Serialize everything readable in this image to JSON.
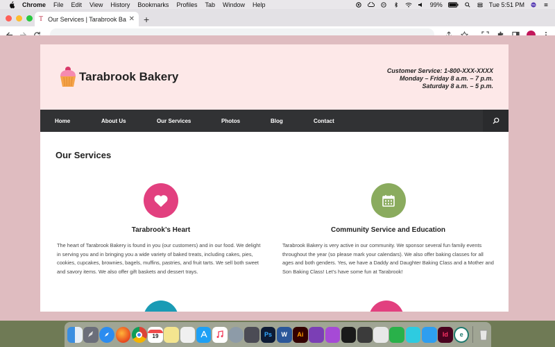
{
  "menubar": {
    "menus": [
      "Chrome",
      "File",
      "Edit",
      "View",
      "History",
      "Bookmarks",
      "Profiles",
      "Tab",
      "Window",
      "Help"
    ],
    "battery": "99%",
    "clock": "Tue 5:51 PM"
  },
  "browser": {
    "tab_title": "Our Services | Tarabrook Bake",
    "tab_favicon": "T",
    "new_tab": "+"
  },
  "site": {
    "brand": "Tarabrook Bakery",
    "contact": {
      "line1": "Customer Service: 1-800-XXX-XXXX",
      "line2": "Monday – Friday 8 a.m. – 7 p.m.",
      "line3": "Saturday 8 a.m. – 5 p.m."
    },
    "nav": [
      "Home",
      "About Us",
      "Our Services",
      "Photos",
      "Blog",
      "Contact"
    ],
    "page_title": "Our Services",
    "services": [
      {
        "title": "Tarabrook’s Heart",
        "icon": "heart-icon",
        "color": "#e2407f",
        "text": "The heart of Tarabrook Bakery is found in you (our customers) and in our food. We delight in serving you and in bringing you a wide variety of baked treats, including cakes, pies, cookies, cupcakes, brownies, bagels, muffins, pastries, and fruit tarts. We sell both sweet and savory items. We also offer gift baskets and dessert trays."
      },
      {
        "title": "Community Service and Education",
        "icon": "calendar-icon",
        "color": "#8aab5e",
        "text": "Tarabrook Bakery is very active in our community. We sponsor several fun family events throughout the year (so please mark your calendars). We also offer baking classes for all ages and both genders. Yes, we have a Daddy and Daughter Baking Class and a Mother and Son Baking Class! Let’s have some fun at Tarabrook!"
      }
    ]
  },
  "dock": {
    "calendar_day": "19",
    "ps": "Ps",
    "word": "W",
    "ai": "Ai",
    "id": "Id",
    "e": "e"
  },
  "colors": {
    "header_bg": "#fde8e8",
    "nav_bg": "#313234",
    "page_bg": "#dfbcc0",
    "partial_teal": "#1a9bb5",
    "partial_pink": "#e2407f"
  }
}
